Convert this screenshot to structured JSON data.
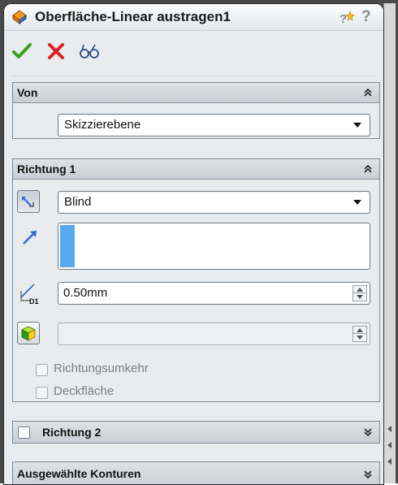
{
  "title": "Oberfläche-Linear austragen1",
  "actions": {
    "ok_icon": "checkmark-icon",
    "cancel_icon": "x-icon",
    "preview_icon": "glasses-icon"
  },
  "von": {
    "header": "Von",
    "select_value": "Skizzierebene"
  },
  "richtung1": {
    "header": "Richtung 1",
    "end_condition": "Blind",
    "depth_value": "0.50mm",
    "depth_label": "D1",
    "options": [
      {
        "label": "Richtungsumkehr"
      },
      {
        "label": "Deckfläche"
      }
    ]
  },
  "richtung2": {
    "header": "Richtung 2"
  },
  "konturen": {
    "header": "Ausgewählte Konturen"
  },
  "colors": {
    "accent_blue": "#58a8f0",
    "cancel_red": "#e02020",
    "ok_green": "#3aa020"
  }
}
